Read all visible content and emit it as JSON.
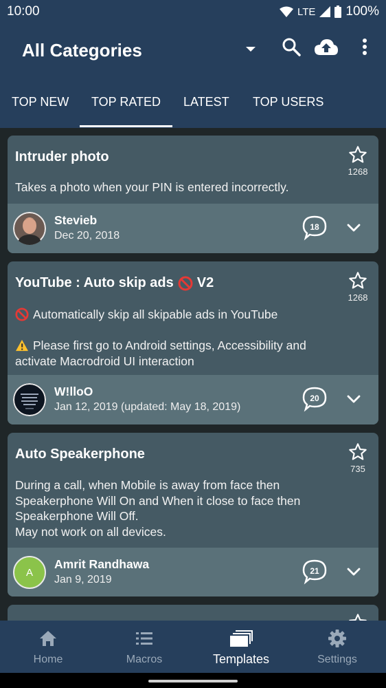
{
  "status_bar": {
    "time": "10:00",
    "network": "LTE",
    "battery": "100%"
  },
  "app_bar": {
    "title": "All Categories",
    "icons": [
      "dropdown-arrow-icon",
      "search-icon",
      "cloud-upload-icon",
      "more-vert-icon"
    ]
  },
  "tabs": [
    {
      "label": "TOP NEW"
    },
    {
      "label": "TOP RATED",
      "selected": true
    },
    {
      "label": "LATEST"
    },
    {
      "label": "TOP USERS"
    }
  ],
  "cards": [
    {
      "title": "Intruder photo",
      "rating": "1268",
      "description": [
        "Takes a photo when your PIN is entered incorrectly."
      ],
      "author": "Stevieb",
      "date": "Dec 20, 2018",
      "comments": "18"
    },
    {
      "title": "YouTube : Auto skip ads",
      "title_suffix": "V2",
      "rating": "1268",
      "description": [
        "Automatically skip all skipable ads in YouTube",
        "",
        "Please first go to Android settings, Accessibility and",
        "activate Macrodroid UI interaction"
      ],
      "author": "W!lloO",
      "date": "Jan 12, 2019 (updated: May 18, 2019)",
      "comments": "20"
    },
    {
      "title": "Auto Speakerphone",
      "rating": "735",
      "description": [
        "During a call, when Mobile is away from face then",
        "Speakerphone Will On and When it close to face then",
        "Speakerphone Will Off.",
        "May not work on all devices."
      ],
      "author": "Amrit Randhawa",
      "avatar_initial": "A",
      "date": "Jan 9, 2019",
      "comments": "21"
    }
  ],
  "bottom_nav": [
    {
      "label": "Home",
      "icon": "home-icon"
    },
    {
      "label": "Macros",
      "icon": "list-icon"
    },
    {
      "label": "Templates",
      "icon": "templates-icon",
      "active": true
    },
    {
      "label": "Settings",
      "icon": "gear-icon"
    }
  ],
  "colors": {
    "app_bar": "#263f5c",
    "card": "#455a64",
    "card_footer": "#5a7179",
    "background": "#1f2628",
    "avatar_green": "#8bc34a"
  }
}
